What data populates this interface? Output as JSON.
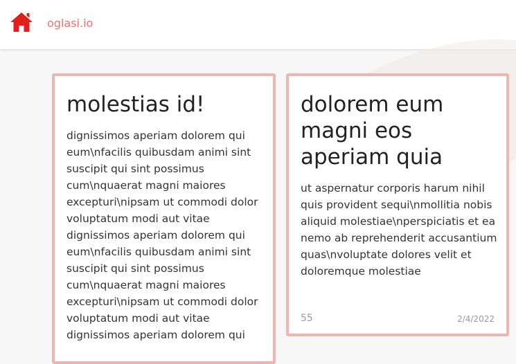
{
  "navbar": {
    "home_icon": "home-icon",
    "brand": "oglasi.io",
    "accent_color": "#e0201b",
    "brand_color": "#e57373"
  },
  "cards": [
    {
      "title": "molestias id!",
      "body": "dignissimos aperiam dolorem qui eum\\nfacilis quibusdam animi sint suscipit qui sint possimus cum\\nquaerat magni maiores excepturi\\nipsam ut commodi dolor voluptatum modi aut vitae dignissimos aperiam dolorem qui eum\\nfacilis quibusdam animi sint suscipit qui sint possimus cum\\nquaerat magni maiores excepturi\\nipsam ut commodi dolor voluptatum modi aut vitae dignissimos aperiam dolorem qui"
    },
    {
      "title": "dolorem eum magni eos aperiam quia",
      "body": "ut aspernatur corporis harum nihil quis provident sequi\\nmollitia nobis aliquid molestiae\\nperspiciatis et ea nemo ab reprehenderit accusantium quas\\nvoluptate dolores velit et doloremque molestiae",
      "count": "55",
      "date": "2/4/2022"
    }
  ],
  "card_border_color": "#efb5b1"
}
